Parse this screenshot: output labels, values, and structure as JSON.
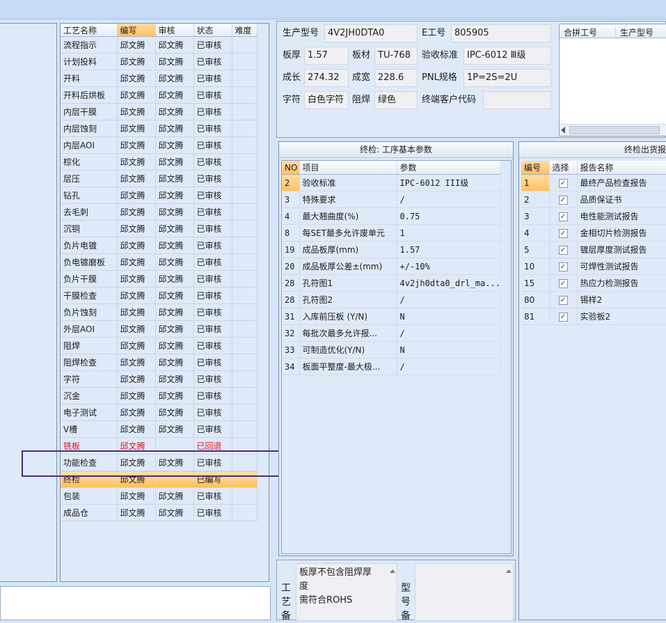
{
  "process_table": {
    "headers": [
      "工艺名称",
      "编写",
      "审核",
      "状态",
      "难度"
    ],
    "rows": [
      {
        "name": "流程指示",
        "author": "邱文腾",
        "reviewer": "邱文腾",
        "status": "已审核",
        "level": "",
        "style": "normal"
      },
      {
        "name": "计划投料",
        "author": "邱文腾",
        "reviewer": "邱文腾",
        "status": "已审核",
        "level": "",
        "style": "normal"
      },
      {
        "name": "开料",
        "author": "邱文腾",
        "reviewer": "邱文腾",
        "status": "已审核",
        "level": "",
        "style": "normal"
      },
      {
        "name": "开料后烘板",
        "author": "邱文腾",
        "reviewer": "邱文腾",
        "status": "已审核",
        "level": "",
        "style": "normal"
      },
      {
        "name": "内层干膜",
        "author": "邱文腾",
        "reviewer": "邱文腾",
        "status": "已审核",
        "level": "",
        "style": "normal"
      },
      {
        "name": "内层蚀刻",
        "author": "邱文腾",
        "reviewer": "邱文腾",
        "status": "已审核",
        "level": "",
        "style": "normal"
      },
      {
        "name": "内层AOI",
        "author": "邱文腾",
        "reviewer": "邱文腾",
        "status": "已审核",
        "level": "",
        "style": "normal"
      },
      {
        "name": "棕化",
        "author": "邱文腾",
        "reviewer": "邱文腾",
        "status": "已审核",
        "level": "",
        "style": "normal"
      },
      {
        "name": "层压",
        "author": "邱文腾",
        "reviewer": "邱文腾",
        "status": "已审核",
        "level": "",
        "style": "normal"
      },
      {
        "name": "钻孔",
        "author": "邱文腾",
        "reviewer": "邱文腾",
        "status": "已审核",
        "level": "",
        "style": "normal"
      },
      {
        "name": "去毛刺",
        "author": "邱文腾",
        "reviewer": "邱文腾",
        "status": "已审核",
        "level": "",
        "style": "normal"
      },
      {
        "name": "沉铜",
        "author": "邱文腾",
        "reviewer": "邱文腾",
        "status": "已审核",
        "level": "",
        "style": "normal"
      },
      {
        "name": "负片电镀",
        "author": "邱文腾",
        "reviewer": "邱文腾",
        "status": "已审核",
        "level": "",
        "style": "normal"
      },
      {
        "name": "负电镀磨板",
        "author": "邱文腾",
        "reviewer": "邱文腾",
        "status": "已审核",
        "level": "",
        "style": "normal"
      },
      {
        "name": "负片干膜",
        "author": "邱文腾",
        "reviewer": "邱文腾",
        "status": "已审核",
        "level": "",
        "style": "normal"
      },
      {
        "name": "干膜检查",
        "author": "邱文腾",
        "reviewer": "邱文腾",
        "status": "已审核",
        "level": "",
        "style": "normal"
      },
      {
        "name": "负片蚀刻",
        "author": "邱文腾",
        "reviewer": "邱文腾",
        "status": "已审核",
        "level": "",
        "style": "normal"
      },
      {
        "name": "外层AOI",
        "author": "邱文腾",
        "reviewer": "邱文腾",
        "status": "已审核",
        "level": "",
        "style": "normal"
      },
      {
        "name": "阻焊",
        "author": "邱文腾",
        "reviewer": "邱文腾",
        "status": "已审核",
        "level": "",
        "style": "normal"
      },
      {
        "name": "阻焊检查",
        "author": "邱文腾",
        "reviewer": "邱文腾",
        "status": "已审核",
        "level": "",
        "style": "normal"
      },
      {
        "name": "字符",
        "author": "邱文腾",
        "reviewer": "邱文腾",
        "status": "已审核",
        "level": "",
        "style": "normal"
      },
      {
        "name": "沉金",
        "author": "邱文腾",
        "reviewer": "邱文腾",
        "status": "已审核",
        "level": "",
        "style": "normal"
      },
      {
        "name": "电子测试",
        "author": "邱文腾",
        "reviewer": "邱文腾",
        "status": "已审核",
        "level": "",
        "style": "normal"
      },
      {
        "name": "V槽",
        "author": "邱文腾",
        "reviewer": "邱文腾",
        "status": "已审核",
        "level": "",
        "style": "normal"
      },
      {
        "name": "铣板",
        "author": "邱文腾",
        "reviewer": "",
        "status": "已回退",
        "level": "",
        "style": "red"
      },
      {
        "name": "功能检查",
        "author": "邱文腾",
        "reviewer": "邱文腾",
        "status": "已审核",
        "level": "",
        "style": "normal"
      },
      {
        "name": "终检",
        "author": "邱文腾",
        "reviewer": "",
        "status": "已编写",
        "level": "",
        "style": "highlight"
      },
      {
        "name": "包装",
        "author": "邱文腾",
        "reviewer": "邱文腾",
        "status": "已审核",
        "level": "",
        "style": "normal"
      },
      {
        "name": "成品仓",
        "author": "邱文腾",
        "reviewer": "邱文腾",
        "status": "已审核",
        "level": "",
        "style": "normal"
      }
    ]
  },
  "info": {
    "model_label": "生产型号",
    "model_value": "4V2JH0DTA0",
    "eno_label": "E工号",
    "eno_value": "805905",
    "thick_label": "板厚",
    "thick_value": "1.57",
    "material_label": "板材",
    "material_value": "TU-768",
    "standard_label": "验收标准",
    "standard_value": "IPC-6012 Ⅲ级",
    "length_label": "成长",
    "length_value": "274.32",
    "width_label": "成宽",
    "width_value": "228.6",
    "pnl_label": "PNL规格",
    "pnl_value": "1P=2S=2U",
    "char_label": "字符",
    "char_value": "白色字符",
    "mask_label": "阻焊",
    "mask_value": "绿色",
    "cust_label": "终端客户代码",
    "cust_value": ""
  },
  "combine": {
    "headers": [
      "合拼工号",
      "生产型号"
    ]
  },
  "params": {
    "title": "终检: 工序基本参数",
    "headers": [
      "NO",
      "项目",
      "参数"
    ],
    "rows": [
      {
        "no": "2",
        "item": "验收标准",
        "value": "IPC-6012 III级"
      },
      {
        "no": "3",
        "item": "特殊要求",
        "value": "/"
      },
      {
        "no": "4",
        "item": "最大翘曲度(%)",
        "value": "0.75"
      },
      {
        "no": "8",
        "item": "每SET最多允许废单元",
        "value": "1"
      },
      {
        "no": "19",
        "item": "成品板厚(mm)",
        "value": "1.57"
      },
      {
        "no": "20",
        "item": "成品板厚公差±(mm)",
        "value": "+/-10%"
      },
      {
        "no": "28",
        "item": "孔符图1",
        "value": "4v2jh0dta0_drl_ma..."
      },
      {
        "no": "28",
        "item": "孔符图2",
        "value": "/"
      },
      {
        "no": "31",
        "item": "入库前压板 (Y/N)",
        "value": "N"
      },
      {
        "no": "32",
        "item": "每批次最多允许报...",
        "value": "/"
      },
      {
        "no": "33",
        "item": "可制造优化(Y/N)",
        "value": "N"
      },
      {
        "no": "34",
        "item": "板面平整度-最大极...",
        "value": "/"
      }
    ]
  },
  "reports": {
    "title": "终检出货报",
    "headers": [
      "编号",
      "选择",
      "报告名称"
    ],
    "rows": [
      {
        "no": "1",
        "checked": "✓",
        "name": "最终产品检查报告"
      },
      {
        "no": "2",
        "checked": "✓",
        "name": "品质保证书"
      },
      {
        "no": "3",
        "checked": "✓",
        "name": "电性能测试报告"
      },
      {
        "no": "4",
        "checked": "✓",
        "name": "金相切片检测报告"
      },
      {
        "no": "5",
        "checked": "✓",
        "name": "镀层厚度测试报告"
      },
      {
        "no": "10",
        "checked": "✓",
        "name": "可焊性测试报告"
      },
      {
        "no": "15",
        "checked": "✓",
        "name": "热应力检测报告"
      },
      {
        "no": "80",
        "checked": "✓",
        "name": "锡样2"
      },
      {
        "no": "81",
        "checked": "✓",
        "name": "实验板2"
      }
    ]
  },
  "notes": {
    "label1": "工艺备",
    "text1_line1": "板厚不包含阻焊厚",
    "text1_line2": "度",
    "text1_line3": "需符合ROHS",
    "label2": "型号备"
  },
  "colors": {
    "highlight": "#ffbe5c",
    "annotation_box": "#4b2a7a",
    "rejected": "#e0141e"
  }
}
